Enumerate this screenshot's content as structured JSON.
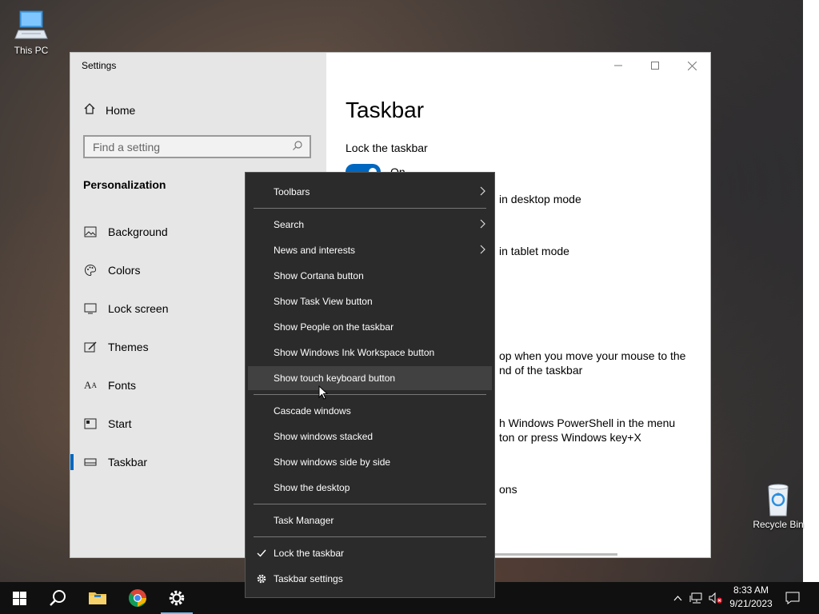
{
  "desktop": {
    "icons": [
      {
        "label": "This PC"
      },
      {
        "label": "Recycle Bin"
      }
    ]
  },
  "settings_window": {
    "title": "Settings",
    "home_label": "Home",
    "search_placeholder": "Find a setting",
    "section_title": "Personalization",
    "nav": [
      {
        "label": "Background",
        "icon": "image-icon"
      },
      {
        "label": "Colors",
        "icon": "palette-icon"
      },
      {
        "label": "Lock screen",
        "icon": "monitor-icon"
      },
      {
        "label": "Themes",
        "icon": "brush-icon"
      },
      {
        "label": "Fonts",
        "icon": "font-icon"
      },
      {
        "label": "Start",
        "icon": "start-grid-icon"
      },
      {
        "label": "Taskbar",
        "icon": "taskbar-icon",
        "active": true
      }
    ],
    "page_title": "Taskbar",
    "lock_label": "Lock the taskbar",
    "toggle_state": "On",
    "visible_fragments": [
      "in desktop mode",
      "in tablet mode",
      "op when you move your mouse to the",
      "nd of the taskbar",
      "h Windows PowerShell in the menu",
      "ton or press Windows key+X",
      "ons"
    ]
  },
  "context_menu": {
    "items": [
      {
        "label": "Toolbars",
        "submenu": true
      },
      {
        "label": "Search",
        "submenu": true
      },
      {
        "label": "News and interests",
        "submenu": true
      },
      {
        "label": "Show Cortana button"
      },
      {
        "label": "Show Task View button"
      },
      {
        "label": "Show People on the taskbar"
      },
      {
        "label": "Show Windows Ink Workspace button"
      },
      {
        "label": "Show touch keyboard button",
        "highlighted": true
      },
      {
        "label": "Cascade windows"
      },
      {
        "label": "Show windows stacked"
      },
      {
        "label": "Show windows side by side"
      },
      {
        "label": "Show the desktop"
      },
      {
        "label": "Task Manager"
      },
      {
        "label": "Lock the taskbar",
        "checked": true
      },
      {
        "label": "Taskbar settings",
        "icon": "gear-icon"
      }
    ]
  },
  "taskbar": {
    "time": "8:33 AM",
    "date": "9/21/2023",
    "accent": "#76b9ed"
  }
}
